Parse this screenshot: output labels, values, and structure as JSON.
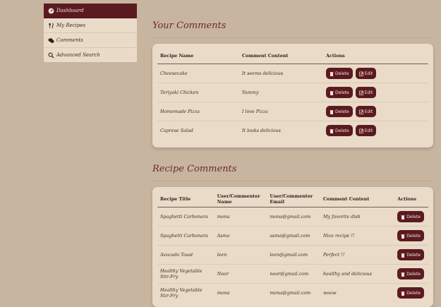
{
  "sidebar": {
    "items": [
      {
        "label": "Dashboard",
        "icon": "dashboard-icon",
        "active": true
      },
      {
        "label": "My Recipes",
        "icon": "utensils-icon",
        "active": false
      },
      {
        "label": "Comments",
        "icon": "comments-icon",
        "active": false
      },
      {
        "label": "Advanced Search",
        "icon": "search-icon",
        "active": false
      }
    ]
  },
  "your_comments": {
    "title": "Your Comments",
    "columns": [
      "Recipe Name",
      "Comment Content",
      "Actions"
    ],
    "rows": [
      {
        "recipe": "Cheesecake",
        "comment": "It seems delicious"
      },
      {
        "recipe": "Teriyaki Chicken",
        "comment": "Yummy"
      },
      {
        "recipe": "Homemade Pizza",
        "comment": "I love Pizza"
      },
      {
        "recipe": "Caprese Salad",
        "comment": "It looks delicious"
      }
    ],
    "delete_label": "Delete",
    "edit_label": "Edit"
  },
  "recipe_comments": {
    "title": "Recipe Comments",
    "columns": [
      "Recipe Title",
      "User/Commenter Name",
      "User/Commenter Email",
      "Comment Content",
      "Actions"
    ],
    "rows": [
      {
        "title": "Spaghetti Carbonara",
        "name": "mona",
        "email": "mona@gmail.com",
        "comment": "My favorite dish"
      },
      {
        "title": "Spaghetti Carbonara",
        "name": "Asma",
        "email": "asma@gmail.com",
        "comment": "Nice recipe !!"
      },
      {
        "title": "Avocado Toast",
        "name": "leen",
        "email": "leen@gmail.com",
        "comment": "Perfect !!"
      },
      {
        "title": "Healthy Vegetable Stir-Fry",
        "name": "Noor",
        "email": "noor@gmail.com",
        "comment": "healthy and delicious"
      },
      {
        "title": "Healthy Vegetable Stir-Fry",
        "name": "mona",
        "email": "mona@gmail.com",
        "comment": "woow"
      }
    ],
    "delete_label": "Delete"
  },
  "colors": {
    "accent": "#5b1a20",
    "background": "#c8b5a0",
    "card": "#eadbc8",
    "title": "#6a2a2c"
  }
}
